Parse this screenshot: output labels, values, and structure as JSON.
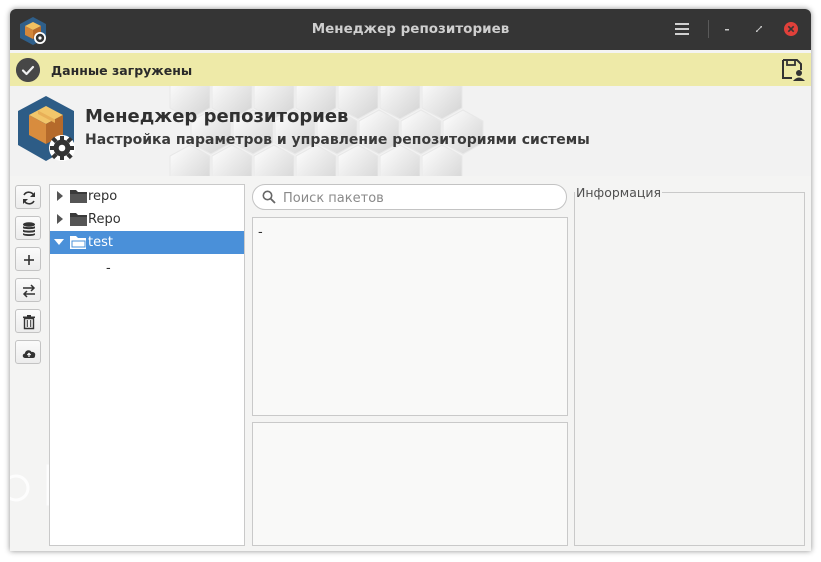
{
  "window": {
    "title": "Менеджер репозиториев"
  },
  "notification": {
    "text": "Данные загружены"
  },
  "header": {
    "title": "Менеджер репозиториев",
    "subtitle": "Настройка параметров и управление репозиториями системы"
  },
  "toolbar": {
    "buttons": [
      {
        "icon": "refresh-icon"
      },
      {
        "icon": "database-icon"
      },
      {
        "icon": "plus-icon"
      },
      {
        "icon": "swap-icon"
      },
      {
        "icon": "trash-icon"
      },
      {
        "icon": "cloud-upload-icon"
      }
    ]
  },
  "tree": {
    "items": [
      {
        "label": "repo",
        "expanded": false,
        "selected": false
      },
      {
        "label": "Repo",
        "expanded": false,
        "selected": false
      },
      {
        "label": "test",
        "expanded": true,
        "selected": true
      }
    ],
    "child_label": "-"
  },
  "search": {
    "placeholder": "Поиск пакетов",
    "value": ""
  },
  "packages": {
    "items": [
      "-"
    ]
  },
  "info": {
    "label": "Информация"
  },
  "colors": {
    "titlebar": "#353535",
    "notification": "#eeeaa8",
    "selection": "#4a90d9",
    "close": "#e0403a"
  }
}
